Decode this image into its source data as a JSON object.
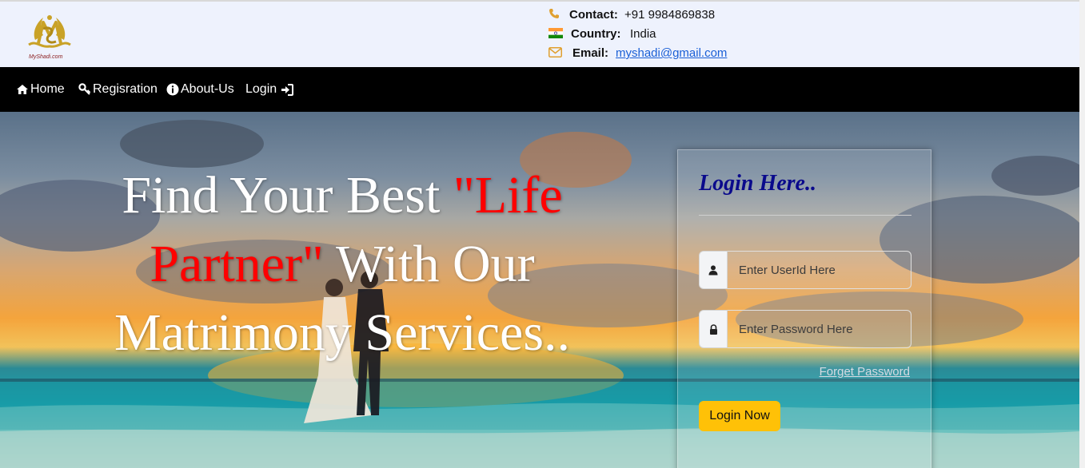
{
  "header": {
    "logo_text": "MyShadi.com",
    "contact_label": "Contact:",
    "contact_value": "+91 9984869838",
    "country_label": "Country:",
    "country_value": "India",
    "email_label": "Email:",
    "email_value": "myshadi@gmail.com"
  },
  "nav": {
    "home": "Home",
    "registration": "Regisration",
    "about": "About-Us",
    "login": "Login"
  },
  "hero": {
    "line1_white": "Find Your Best ",
    "line1_red": "\"Life",
    "line2_red": "Partner\"",
    "line2_white": " With Our",
    "line3_white": "Matrimony Services.."
  },
  "login_form": {
    "title": "Login Here..",
    "userid_placeholder": "Enter UserId Here",
    "password_placeholder": "Enter Password Here",
    "forget_link": "Forget Password",
    "submit_label": "Login Now"
  },
  "colors": {
    "accent_red": "#ff0000",
    "button_yellow": "#ffc107",
    "title_navy": "#0a0a8c",
    "logo_gold": "#c9a227"
  }
}
